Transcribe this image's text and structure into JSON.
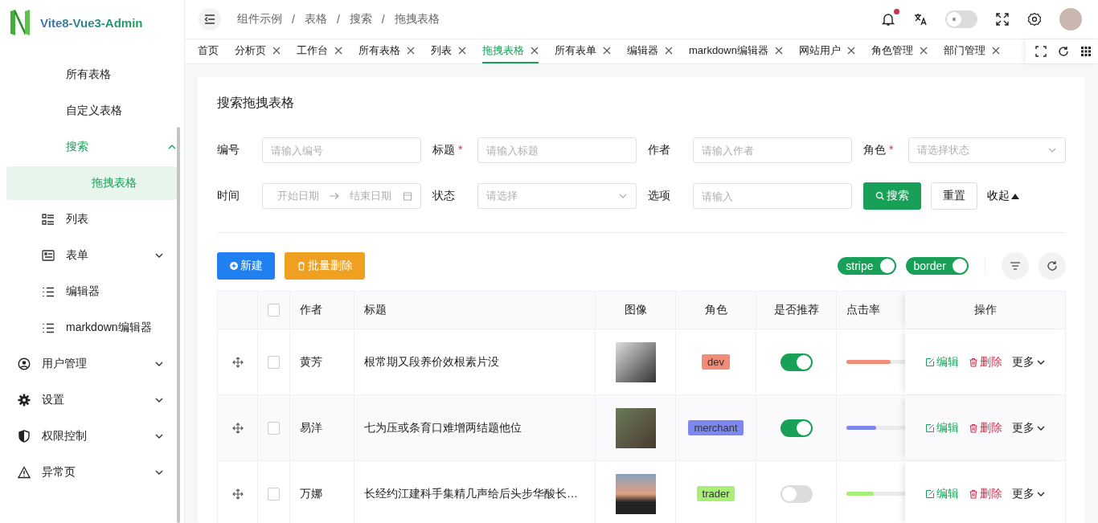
{
  "sidebar": {
    "logo": "Vite8-Vue3-Admin",
    "items": [
      {
        "children": [
          {
            "children": [
              {
                "label": "所有表格",
                "selected": false
              },
              {
                "label": "自定义表格",
                "selected": false
              },
              {
                "label": "搜索",
                "selected": false,
                "expanded": true,
                "children": [
                  {
                    "label": "拖拽表格",
                    "selected": true
                  }
                ]
              }
            ]
          },
          {
            "label": "列表",
            "selected": false
          },
          {
            "label": "表单",
            "selected": false,
            "expanded": false
          },
          {
            "label": "编辑器",
            "selected": false
          },
          {
            "label": "markdown编辑器",
            "selected": false
          }
        ]
      },
      {
        "label": "用户管理",
        "selected": false,
        "expanded": false
      },
      {
        "label": "设置",
        "selected": false,
        "expanded": false
      },
      {
        "label": "权限控制",
        "selected": false,
        "expanded": false
      },
      {
        "label": "异常页",
        "selected": false,
        "expanded": false
      }
    ]
  },
  "header": {
    "breadcrumb": [
      "组件示例",
      "表格",
      "搜索",
      "拖拽表格"
    ],
    "breadcrumb_separator": "/",
    "notification_dot": true,
    "theme_switch_on": false
  },
  "tabs": [
    {
      "label": "首页",
      "closable": false,
      "selected": false
    },
    {
      "label": "分析页",
      "closable": true,
      "selected": false
    },
    {
      "label": "工作台",
      "closable": true,
      "selected": false
    },
    {
      "label": "所有表格",
      "closable": true,
      "selected": false
    },
    {
      "label": "列表",
      "closable": true,
      "selected": false
    },
    {
      "label": "拖拽表格",
      "closable": true,
      "selected": true
    },
    {
      "label": "所有表单",
      "closable": true,
      "selected": false
    },
    {
      "label": "编辑器",
      "closable": true,
      "selected": false
    },
    {
      "label": "markdown编辑器",
      "closable": true,
      "selected": false
    },
    {
      "label": "网站用户",
      "closable": true,
      "selected": false
    },
    {
      "label": "角色管理",
      "closable": true,
      "selected": false
    },
    {
      "label": "部门管理",
      "closable": true,
      "selected": false
    }
  ],
  "card": {
    "title": "搜索拖拽表格",
    "required_mark": "*",
    "fields": [
      {
        "kind": "input",
        "label": "编号",
        "required": false,
        "placeholder": "请输入编号"
      },
      {
        "kind": "input",
        "label": "标题",
        "required": true,
        "placeholder": "请输入标题"
      },
      {
        "kind": "input",
        "label": "作者",
        "required": false,
        "placeholder": "请输入作者"
      },
      {
        "kind": "select",
        "label": "角色",
        "required": true,
        "placeholder": "请选择状态"
      },
      {
        "kind": "daterange",
        "label": "时间",
        "required": false,
        "placeholder": "开始日期",
        "placeholder_end": "结束日期"
      },
      {
        "kind": "select",
        "label": "状态",
        "required": false,
        "placeholder": "请选择"
      },
      {
        "kind": "input",
        "label": "选项",
        "required": false,
        "placeholder": "请输入"
      }
    ],
    "search_button": "搜索",
    "reset_button": "重置",
    "collapse_link": "收起",
    "new_button": "新建",
    "batch_delete_button": "批量删除",
    "switches": [
      {
        "label": "stripe",
        "on": true
      },
      {
        "label": "border",
        "on": true
      }
    ],
    "table": {
      "columns": [
        "作者",
        "标题",
        "图像",
        "角色",
        "是否推荐",
        "点击率",
        "操作"
      ],
      "all_checked": false,
      "rows": [
        {
          "checked": false,
          "author": "黄芳",
          "title": "根常期又段养价效根素片没",
          "role": "dev",
          "color": "#f28c76",
          "recommended": true,
          "level": 0.55,
          "actions": [
            "编辑",
            "删除",
            "更多"
          ]
        },
        {
          "checked": false,
          "author": "易洋",
          "title": "七为压或条育口难增两结题他位",
          "role": "merchant",
          "color": "#7e87f0",
          "recommended": true,
          "level": 0.37,
          "actions": [
            "编辑",
            "删除",
            "更多"
          ]
        },
        {
          "checked": false,
          "author": "万娜",
          "title": "长经约江建科手集精几声给后头步华酸长…",
          "role": "trader",
          "color": "#a8ee77",
          "recommended": false,
          "level": 0.34,
          "actions": [
            "编辑",
            "删除",
            "更多"
          ]
        }
      ]
    }
  }
}
